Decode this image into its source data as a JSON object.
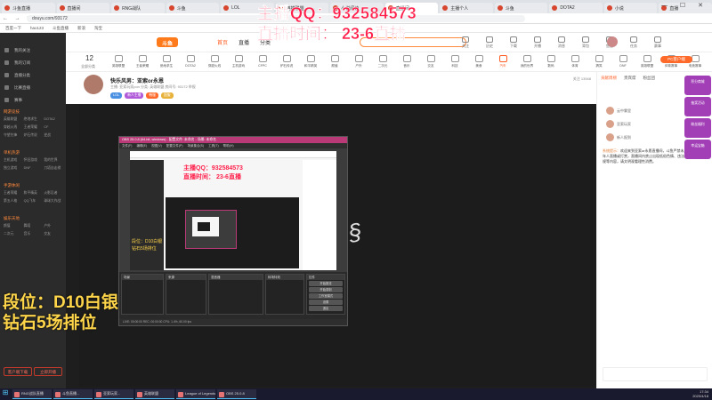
{
  "browser": {
    "tabs": [
      "斗鱼直播",
      "直播间",
      "RNG战队",
      "斗鱼",
      "LOL",
      "英雄联盟",
      "小说阅读",
      "直播间",
      "主播个人",
      "斗鱼",
      "DOTA2",
      "小说",
      "直播"
    ],
    "url": "douyu.com/93172"
  },
  "bookmarks": [
    "百度一下",
    "hao123",
    "斗鱼直播",
    "新浪",
    "淘宝"
  ],
  "overlay": {
    "qq": "主播QQ：932584573",
    "time": "直播时间：  23-6直播",
    "rank1": "段位：D10白银",
    "rank2": "钻石5场排位"
  },
  "sidebar": {
    "top_items": [
      "我的关注",
      "我的订阅",
      "直播分类",
      "比赛直播",
      "赛事"
    ],
    "sections": [
      {
        "title": "网游竞技",
        "grid": [
          "英雄联盟",
          "绝地求生",
          "DOTA2",
          "穿越火线",
          "王者荣耀",
          "CF",
          "守望先锋",
          "炉石传说",
          "逆战"
        ]
      },
      {
        "title": "单机热游",
        "grid": [
          "主机游戏",
          "怀旧游戏",
          "我的世界",
          "独立游戏",
          "DNF",
          "刀塔自走棋"
        ]
      },
      {
        "title": "手游休闲",
        "grid": [
          "王者荣耀",
          "和平精英",
          "火影忍者",
          "第五人格",
          "QQ飞车",
          "球球大作战"
        ]
      },
      {
        "title": "娱乐天地",
        "grid": [
          "颜值",
          "舞蹈",
          "户外",
          "二次元",
          "音乐",
          "交友"
        ]
      }
    ],
    "cta_left": "客户端下载",
    "cta_right": "立即开播"
  },
  "header": {
    "logo": "斗鱼",
    "nav": [
      "首页",
      "直播",
      "分类"
    ],
    "icons": [
      "关注",
      "历史",
      "下载",
      "开播",
      "消息",
      "背包",
      "鱼翅",
      "任务",
      "赛事"
    ]
  },
  "categories": {
    "count": "12",
    "count_label": "全部分类",
    "items": [
      "英雄联盟",
      "王者荣耀",
      "绝地求生",
      "DOTA2",
      "穿越火线",
      "主机游戏",
      "CFPC",
      "炉石传说",
      "和平精英",
      "颜值",
      "户外",
      "二次元",
      "音乐",
      "交友",
      "科技",
      "美食",
      "汽车",
      "我的世界",
      "数码",
      "体育",
      "搞笑",
      "DNF",
      "英雄联盟",
      "体育赛事",
      "电竞赛事",
      "正能量",
      "云游戏",
      "斗鱼公益"
    ],
    "active_index": 16,
    "pc_button": "PC客户端"
  },
  "room": {
    "title": "快乐风男：亚索or永恩",
    "meta": "主播: 亚索玩家pon  分类: 英雄联盟  房间号: 93172  举报",
    "tags": [
      "LOL",
      "新人主播",
      "韩服",
      "国服"
    ],
    "tag_colors": [
      "#4a90e2",
      "#b05ad9",
      "#ff6a2b",
      "#e8b23a"
    ],
    "right_info": "关注 13948"
  },
  "obs": {
    "title": "OBS 25.0.8 (64-bit, windows) - 配置文件: 未命名 - 场景: 未命名",
    "menu": [
      "文件(F)",
      "编辑(E)",
      "视图(V)",
      "配置文件(P)",
      "场景集合(S)",
      "工具(T)",
      "帮助(H)"
    ],
    "docks": [
      "场景",
      "来源",
      "混音器",
      "转场特效",
      "控件"
    ],
    "buttons": [
      "开始推流",
      "开始录制",
      "工作室模式",
      "设置",
      "退出"
    ],
    "status": "LIVE: 00:00:00   REC: 00:00:00   CPU: 1.4%, 60.00 fps"
  },
  "rightpanel": {
    "tabs": [
      "贡献周榜",
      "贵宾席",
      "粉丝团"
    ],
    "list": [
      "云中雾里",
      "亚索玩家",
      "新人报到"
    ],
    "chat": [
      {
        "user": "系统提示：",
        "text": "欢迎来到亚索or永恩直播间，斗鱼严禁未成年人直播或打赏，直播间内禁止出现低俗色情、违法违规等内容，请文明观看理性消费。"
      }
    ],
    "floats": [
      "积分商城",
      "抽奖活动",
      "粉丝福利",
      "幸运宝箱"
    ]
  },
  "taskbar": {
    "items": [
      "RNG战队直播",
      "斗鱼直播...",
      "亚索玩家...",
      "英雄联盟",
      "League of Legends",
      "OBS 25.0.8"
    ],
    "time": "17:34",
    "date": "2020/4/18"
  }
}
